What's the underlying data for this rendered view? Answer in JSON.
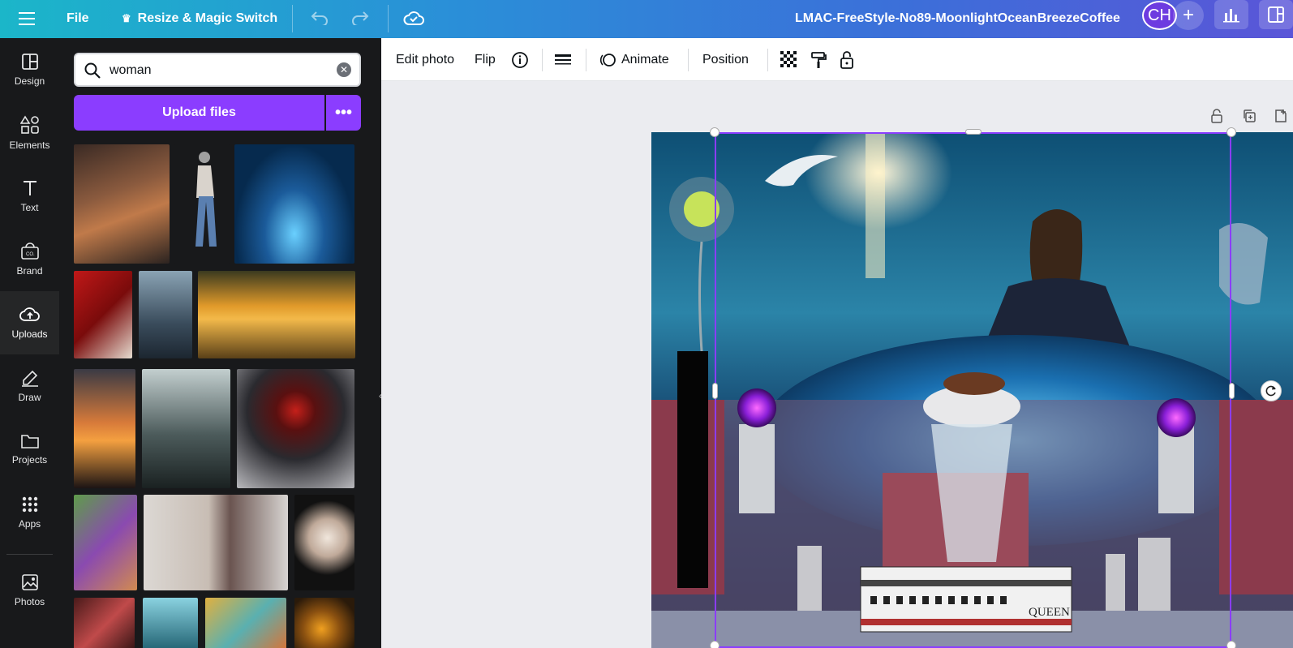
{
  "topbar": {
    "file_label": "File",
    "resize_label": "Resize & Magic Switch",
    "doc_title": "LMAC-FreeStyle-No89-MoonlightOceanBreezeCoffee",
    "avatar_initials": "CH",
    "icons": [
      "menu-icon",
      "crown-icon",
      "undo-icon",
      "redo-icon",
      "cloud-check-icon",
      "plus-icon",
      "analytics-icon",
      "panel-icon"
    ]
  },
  "rail": {
    "items": [
      {
        "label": "Design",
        "icon": "design-icon"
      },
      {
        "label": "Elements",
        "icon": "elements-icon"
      },
      {
        "label": "Text",
        "icon": "text-icon"
      },
      {
        "label": "Brand",
        "icon": "brand-icon"
      },
      {
        "label": "Uploads",
        "icon": "upload-icon",
        "active": true
      },
      {
        "label": "Draw",
        "icon": "draw-icon"
      },
      {
        "label": "Projects",
        "icon": "folder-icon"
      },
      {
        "label": "Apps",
        "icon": "apps-icon"
      },
      {
        "label": "Photos",
        "icon": "photo-icon"
      }
    ]
  },
  "panel": {
    "search_value": "woman",
    "upload_label": "Upload files",
    "more_label": "•••"
  },
  "toolbar": {
    "edit_photo": "Edit photo",
    "flip": "Flip",
    "animate": "Animate",
    "position": "Position"
  },
  "canvas": {
    "boat_text": "QUEEN"
  },
  "colors": {
    "accent": "#8b3dff",
    "rail_bg": "#18191b",
    "topbar_start": "#1bb6c9",
    "topbar_end": "#5a55d8"
  }
}
